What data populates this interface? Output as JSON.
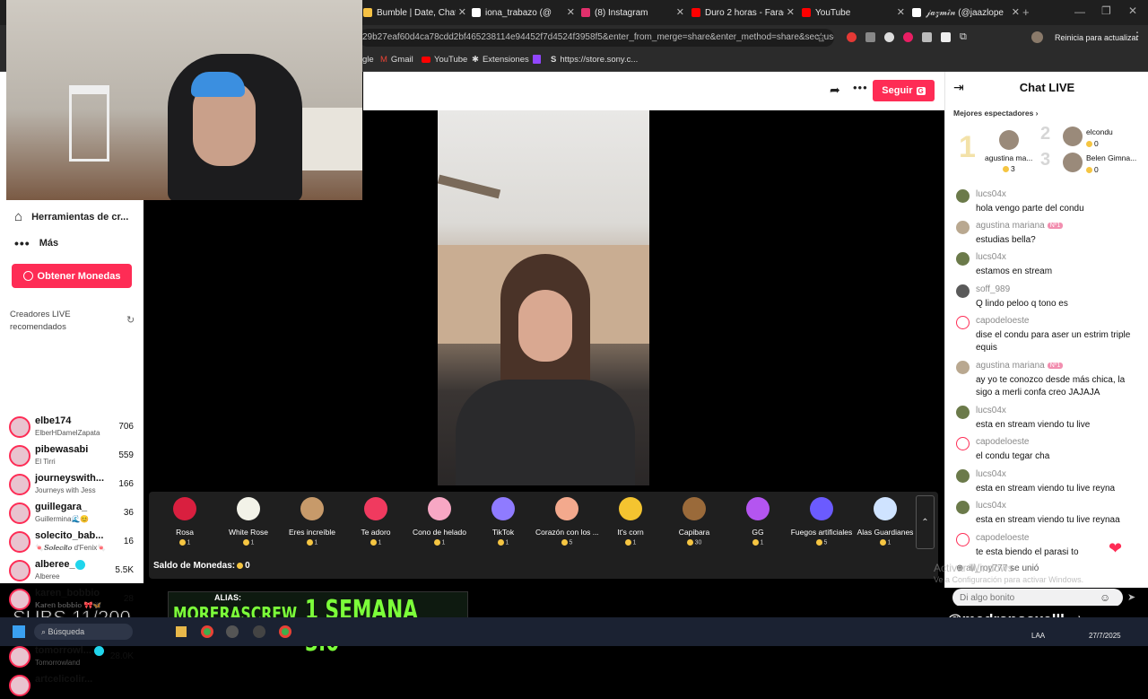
{
  "browser": {
    "tabs": [
      {
        "label": "Bumble | Date, Chat, I",
        "color": "#f6c244"
      },
      {
        "label": "iona_trabazo (@",
        "color": "#ffffff"
      },
      {
        "label": "(8) Instagram",
        "color": "#e1306c"
      },
      {
        "label": "Duro 2 horas - Faraó",
        "color": "#ff0000"
      },
      {
        "label": "YouTube",
        "color": "#ff0000"
      },
      {
        "label": "𝒿𝒶𝓏𝓂𝒾́𝓃 (@jaazlope",
        "color": "#ffffff"
      }
    ],
    "new_tab": "+",
    "url": "29b27eaf60d4ca78cdd2bf465238114e94452f7d4524f3958f5&enter_from_merge=share&enter_method=share&sec_use...",
    "update_button": "Reinicia para actualizar",
    "bookmarks": [
      "gle",
      "Gmail",
      "YouTube",
      "Extensiones",
      "",
      "https://store.sony.c..."
    ]
  },
  "sidebar": {
    "tools_label": "Herramientas de cr...",
    "more_label": "Más",
    "coins_button": "Obtener Monedas",
    "creators_heading": "Creadores LIVE recomendados",
    "creators": [
      {
        "name": "elbe174",
        "sub": "ElberHDamelZapata",
        "count": "706"
      },
      {
        "name": "pibewasabi",
        "sub": "El Tirri",
        "count": "559"
      },
      {
        "name": "journeyswith...",
        "sub": "Journeys with Jess",
        "count": "166"
      },
      {
        "name": "guillegara_",
        "sub": "Guillermina🌊😊",
        "count": "36"
      },
      {
        "name": "solecito_bab...",
        "sub": "🍬𝑺𝒐𝒍𝒆𝒄𝒊𝒕𝒐 d'Fenix🍬",
        "count": "16"
      },
      {
        "name": "alberee_",
        "sub": "Alberee",
        "count": "5.5K"
      },
      {
        "name": "karen_bobbio",
        "sub": "𝐊𝐚𝐫𝐞𝐧 𝐛𝐨𝐛𝐛𝐢𝐨 🎀🦋",
        "count": "28"
      },
      {
        "name": "zoebogach",
        "sub": "Zōe 🪬",
        "count": "535"
      },
      {
        "name": "tomorrowl...",
        "sub": "Tomorrowland",
        "count": "28.0K"
      },
      {
        "name": "artcelicolir...",
        "sub": "",
        "count": ""
      }
    ]
  },
  "header": {
    "follow_label": "Seguir",
    "follow_badge": "G"
  },
  "gifts": [
    {
      "name": "Rosa",
      "price": "1",
      "color": "#d91f3f"
    },
    {
      "name": "White Rose",
      "price": "1",
      "color": "#f2f2e8"
    },
    {
      "name": "Eres increíble",
      "price": "1",
      "color": "#c79a6a"
    },
    {
      "name": "Te adoro",
      "price": "1",
      "color": "#f03a5f"
    },
    {
      "name": "Cono de helado",
      "price": "1",
      "color": "#f7a7c4"
    },
    {
      "name": "TikTok",
      "price": "1",
      "color": "#8f7bff"
    },
    {
      "name": "Corazón con los ...",
      "price": "5",
      "color": "#f3a98d"
    },
    {
      "name": "It's corn",
      "price": "1",
      "color": "#f4c430"
    },
    {
      "name": "Capibara",
      "price": "30",
      "color": "#9a6a3a"
    },
    {
      "name": "GG",
      "price": "1",
      "color": "#b455f0"
    },
    {
      "name": "Fuegos artificiales",
      "price": "5",
      "color": "#6b5bff"
    },
    {
      "name": "Alas Guardianes",
      "price": "1",
      "color": "#cfe3ff"
    }
  ],
  "balance": {
    "label": "Saldo de Monedas:",
    "value": "0"
  },
  "chat": {
    "title": "Chat LIVE",
    "top_viewers_label": "Mejores espectadores",
    "top_viewers": [
      {
        "rank": "1",
        "name": "agustina ma...",
        "score": "3"
      },
      {
        "rank": "2",
        "name": "elcondu",
        "score": "0"
      },
      {
        "rank": "3",
        "name": "Belen Gimna...",
        "score": "0"
      }
    ],
    "messages": [
      {
        "user": "lucs04x",
        "text": "hola vengo parte del condu",
        "badge": ""
      },
      {
        "user": "agustina mariana",
        "text": "estudias bella?",
        "badge": "Nº1"
      },
      {
        "user": "lucs04x",
        "text": "estamos en stream",
        "badge": ""
      },
      {
        "user": "soff_989",
        "text": "Q lindo peloo q tono es",
        "badge": ""
      },
      {
        "user": "capodeloeste",
        "text": "dise el condu para aser un estrim triple equis",
        "badge": ""
      },
      {
        "user": "agustina mariana",
        "text": "ay yo te conozco desde más chica, la sigo a merli confa creo JAJAJA",
        "badge": "Nº1"
      },
      {
        "user": "lucs04x",
        "text": "esta en stream viendo tu live",
        "badge": ""
      },
      {
        "user": "capodeloeste",
        "text": "el condu tegar cha",
        "badge": ""
      },
      {
        "user": "lucs04x",
        "text": "esta en stream viendo tu live reyna",
        "badge": ""
      },
      {
        "user": "lucs04x",
        "text": "esta en stream viendo tu live reynaa",
        "badge": ""
      },
      {
        "user": "capodeloeste",
        "text": "te esta biendo el parasi to",
        "badge": ""
      }
    ],
    "join_user": "ali_roy777",
    "join_text": "se unió",
    "input_placeholder": "Di algo bonito"
  },
  "overlay": {
    "alias_label": "ALIAS:",
    "alias_value": "MORERASCREW",
    "promo": "1 SEMANA 3.0",
    "subs": "SUBS 11/200",
    "handle": "@medranoaxelll",
    "activate_title": "Activar Windows",
    "activate_sub": "Ve a Configuración para activar Windows."
  },
  "taskbar": {
    "search_placeholder": "Búsqueda",
    "lang": "LAA",
    "date": "27/7/2025"
  }
}
